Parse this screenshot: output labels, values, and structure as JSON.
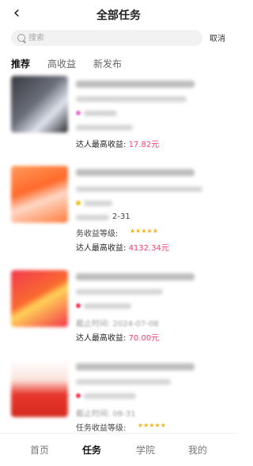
{
  "header": {
    "title": "全部任务",
    "back_icon": "chevron-left-icon"
  },
  "search": {
    "placeholder": "搜索",
    "cancel_label": "取消"
  },
  "tabs": [
    {
      "label": "推荐",
      "active": true
    },
    {
      "label": "高收益",
      "active": false
    },
    {
      "label": "新发布",
      "active": false
    }
  ],
  "cards": [
    {
      "time_prefix": "",
      "max_earning_label": "达人最高收益:",
      "max_earning_value": "17.82元",
      "thumb_colors": [
        "#2a2a2e",
        "#cfd4de"
      ]
    },
    {
      "time_prefix": "2-31",
      "level_label": "务收益等级:",
      "stars": "★★★★★",
      "max_earning_label": "达人最高收益:",
      "max_earning_value": "4132.34元",
      "thumb_colors": [
        "#ff7a3d",
        "#ffd9c4"
      ]
    },
    {
      "time_prefix": "截止时间: 2024-07-08",
      "max_earning_label": "达人最高收益:",
      "max_earning_value": "70.00元",
      "thumb_colors": [
        "#f4344c",
        "#ffd35a"
      ]
    },
    {
      "time_prefix": "截止时间: 08-31",
      "level_label": "任务收益等级:",
      "stars": "★★★★★",
      "thumb_colors": [
        "#ffffff",
        "#e8372c"
      ]
    }
  ],
  "bottom_nav": [
    {
      "label": "首页",
      "active": false
    },
    {
      "label": "任务",
      "active": true
    },
    {
      "label": "学院",
      "active": false
    },
    {
      "label": "我的",
      "active": false
    }
  ],
  "accent_color": "#ff3b6b"
}
